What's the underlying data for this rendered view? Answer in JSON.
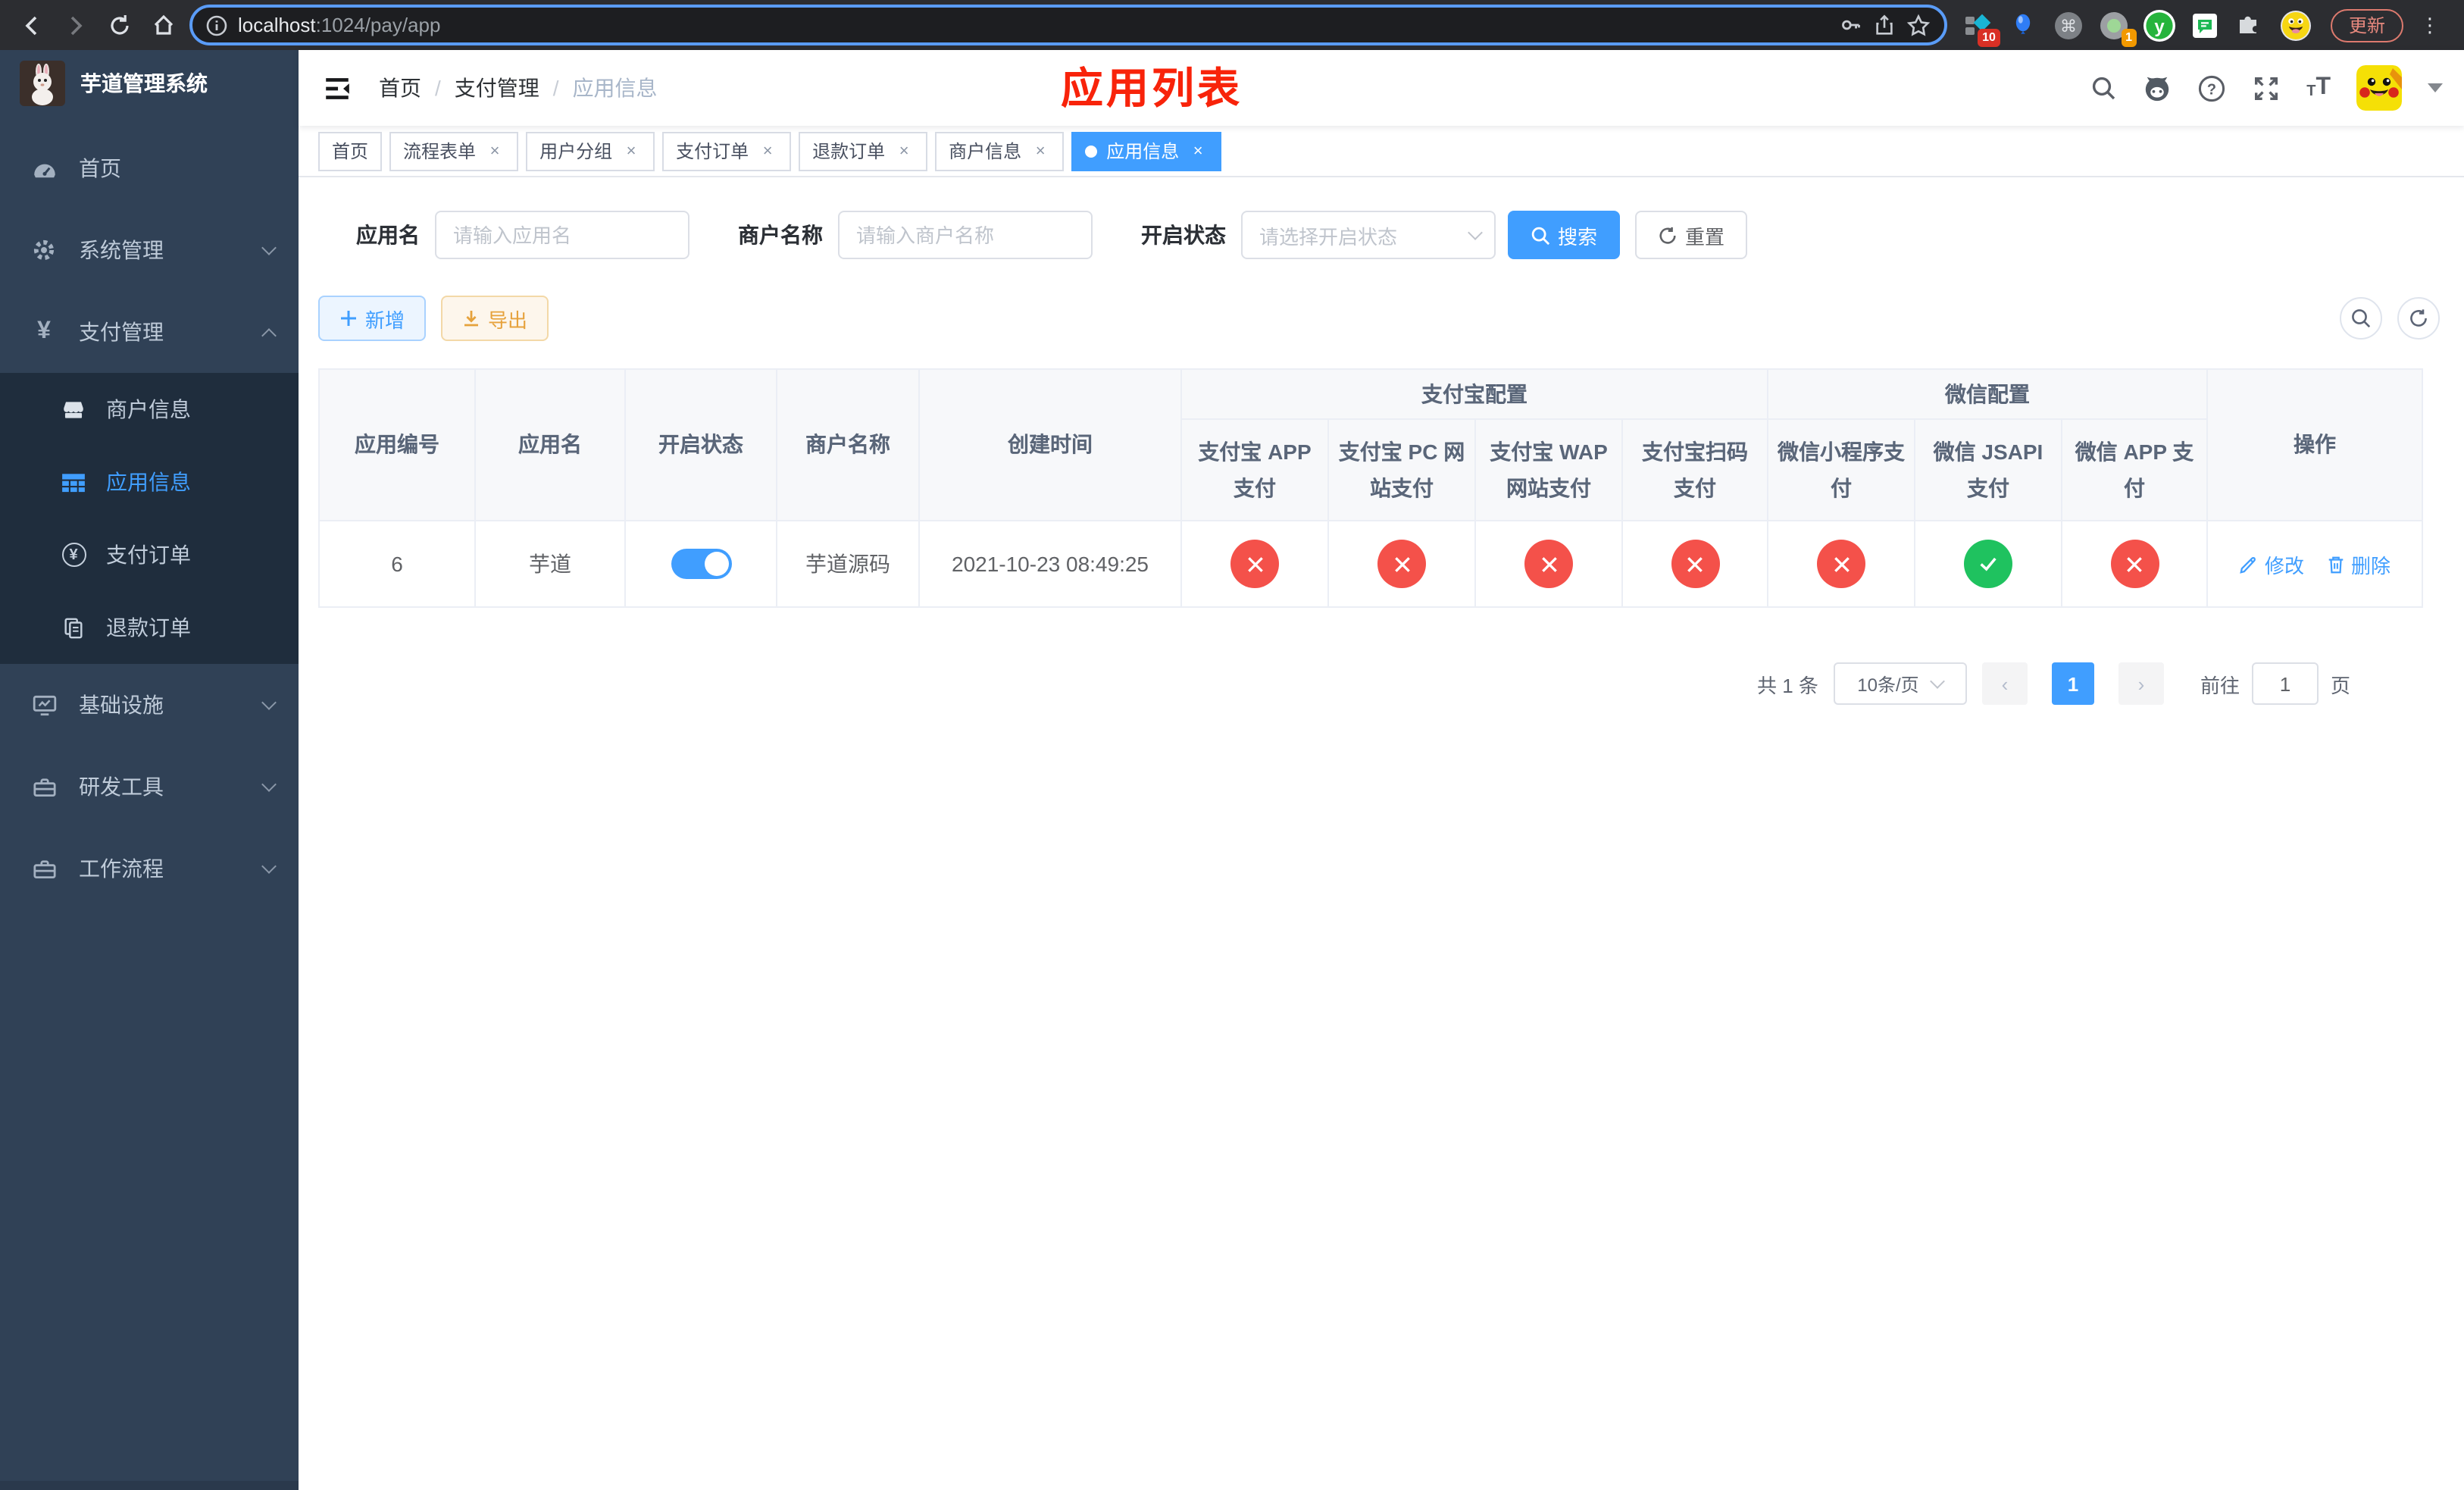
{
  "browser": {
    "url_host": "localhost",
    "url_path": ":1024/pay/app",
    "update_button": "更新",
    "ext_badge_blue_diamond": "10",
    "ext_badge_gray_circle": "1",
    "icons": [
      "back-icon",
      "forward-icon",
      "reload-icon",
      "home-icon",
      "info-icon",
      "key-icon",
      "share-icon",
      "star-icon",
      "puzzle-icon",
      "profile-avatar",
      "menu-dots-icon"
    ]
  },
  "sidebar": {
    "title": "芋道管理系统",
    "items": [
      {
        "label": "首页",
        "icon": "dashboard-icon"
      },
      {
        "label": "系统管理",
        "icon": "gear-icon",
        "state": "collapsed"
      },
      {
        "label": "支付管理",
        "icon": "yen-icon",
        "state": "expanded"
      },
      {
        "label": "基础设施",
        "icon": "monitor-icon",
        "state": "collapsed"
      },
      {
        "label": "研发工具",
        "icon": "toolbox-icon",
        "state": "collapsed"
      },
      {
        "label": "工作流程",
        "icon": "toolbox-icon",
        "state": "collapsed"
      }
    ],
    "submenu": [
      {
        "label": "商户信息",
        "icon": "store-icon",
        "active": false
      },
      {
        "label": "应用信息",
        "icon": "grid-icon",
        "active": true
      },
      {
        "label": "支付订单",
        "icon": "circled-yen-icon",
        "active": false
      },
      {
        "label": "退款订单",
        "icon": "documents-icon",
        "active": false
      }
    ]
  },
  "navbar": {
    "breadcrumb": [
      "首页",
      "支付管理",
      "应用信息"
    ],
    "annotation": "应用列表"
  },
  "tags": {
    "items": [
      "首页",
      "流程表单",
      "用户分组",
      "支付订单",
      "退款订单",
      "商户信息",
      "应用信息"
    ],
    "active": "应用信息"
  },
  "filters": {
    "app_name_label": "应用名",
    "app_name_placeholder": "请输入应用名",
    "merchant_label": "商户名称",
    "merchant_placeholder": "请输入商户名称",
    "status_label": "开启状态",
    "status_placeholder": "请选择开启状态",
    "search_label": "搜索",
    "reset_label": "重置"
  },
  "toolbar": {
    "add_label": "新增",
    "export_label": "导出"
  },
  "table": {
    "columns": [
      "应用编号",
      "应用名",
      "开启状态",
      "商户名称",
      "创建时间"
    ],
    "group_alipay": "支付宝配置",
    "group_wechat": "微信配置",
    "pay_columns": [
      "支付宝 APP 支付",
      "支付宝 PC 网站支付",
      "支付宝 WAP 网站支付",
      "支付宝扫码支付",
      "微信小程序支付",
      "微信 JSAPI 支付",
      "微信 APP 支付"
    ],
    "ops_column": "操作",
    "row": {
      "id": "6",
      "name": "芋道",
      "enabled": true,
      "merchant_name": "芋道源码",
      "create_time": "2021-10-23 08:49:25",
      "channel_status": [
        "disabled",
        "disabled",
        "disabled",
        "disabled",
        "disabled",
        "enabled",
        "disabled"
      ],
      "edit_label": "修改",
      "delete_label": "删除"
    }
  },
  "pagination": {
    "total_text": "共 1 条",
    "page_size": "10条/页",
    "current_page": "1",
    "goto_prefix": "前往",
    "goto_value": "1",
    "goto_suffix": "页"
  },
  "colors": {
    "accent": "#409eff",
    "sidebar_bg": "#304156",
    "submenu_bg": "#1f2d3d",
    "success": "#1fc25f",
    "danger": "#f4514a",
    "warning": "#e6a23c",
    "annotation_red": "#f8230a"
  }
}
